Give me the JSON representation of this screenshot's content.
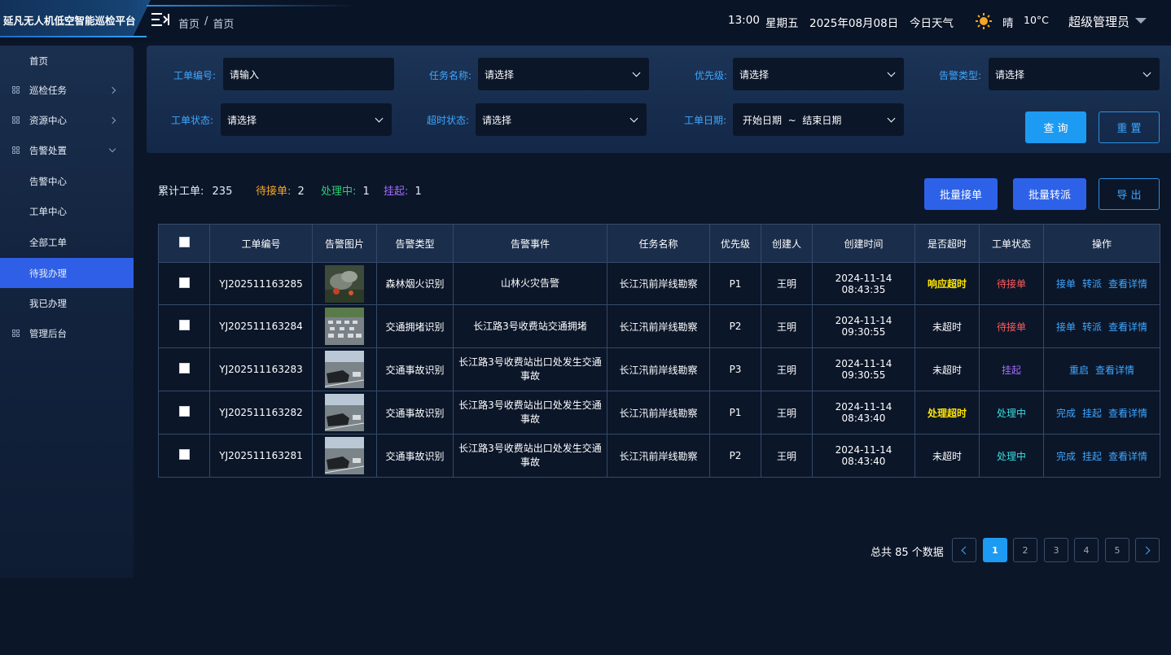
{
  "header": {
    "app_title": "延凡无人机低空智能巡检平台",
    "breadcrumb": [
      "首页",
      "/",
      "首页"
    ],
    "time": "13:00",
    "weekday": "星期五",
    "date": "2025年08月08日",
    "weather_label": "今日天气",
    "weather": "晴",
    "temperature": "10°C",
    "user": "超级管理员"
  },
  "sidebar": {
    "items": [
      {
        "label": "首页",
        "icon": "",
        "chevron": ""
      },
      {
        "label": "巡检任务",
        "icon": "grid-icon",
        "chevron": "right"
      },
      {
        "label": "资源中心",
        "icon": "grid-icon",
        "chevron": "right"
      },
      {
        "label": "告警处置",
        "icon": "grid-icon",
        "chevron": "down"
      },
      {
        "label": "告警中心",
        "icon": "",
        "chevron": ""
      },
      {
        "label": "工单中心",
        "icon": "",
        "chevron": ""
      },
      {
        "label": "全部工单",
        "icon": "",
        "chevron": ""
      },
      {
        "label": "待我办理",
        "icon": "",
        "chevron": "",
        "active": true
      },
      {
        "label": "我已办理",
        "icon": "",
        "chevron": ""
      },
      {
        "label": "管理后台",
        "icon": "grid-icon",
        "chevron": ""
      }
    ]
  },
  "filters": {
    "order_no": {
      "label": "工单编号:",
      "placeholder": "请输入"
    },
    "task_name": {
      "label": "任务名称:",
      "value": "请选择"
    },
    "priority": {
      "label": "优先级:",
      "value": "请选择"
    },
    "alarm_type": {
      "label": "告警类型:",
      "value": "请选择"
    },
    "order_status": {
      "label": "工单状态:",
      "value": "请选择"
    },
    "timeout_status": {
      "label": "超时状态:",
      "value": "请选择"
    },
    "order_date": {
      "label": "工单日期:",
      "value": "开始日期  ~  结束日期"
    },
    "query_label": "查 询",
    "reset_label": "重 置"
  },
  "summary": {
    "total_label": "累计工单:",
    "total": "235",
    "pending_label": "待接单:",
    "pending": "2",
    "processing_label": "处理中:",
    "processing": "1",
    "suspended_label": "挂起:",
    "suspended": "1"
  },
  "actions": {
    "batch_accept": "批量接单",
    "batch_transfer": "批量转派",
    "export": "导 出"
  },
  "table": {
    "columns": [
      "工单编号",
      "告警图片",
      "告警类型",
      "告警事件",
      "任务名称",
      "优先级",
      "创建人",
      "创建时间",
      "是否超时",
      "工单状态",
      "操作"
    ],
    "rows": [
      {
        "id": "YJ202511163285",
        "image": "forest-fire-thumbnail",
        "type": "森林烟火识别",
        "event": "山林火灾告警",
        "task": "长江汛前岸线勘察",
        "priority": "P1",
        "creator": "王明",
        "created": "2024-11-14 08:43:35",
        "timeout": "响应超时",
        "timeout_color": "#ffe600",
        "status": "待接单",
        "status_color": "#ff5b5b",
        "ops": [
          "接单",
          "转派",
          "查看详情"
        ]
      },
      {
        "id": "YJ202511163284",
        "image": "traffic-jam-thumbnail",
        "type": "交通拥堵识别",
        "event": "长江路3号收费站交通拥堵",
        "task": "长江汛前岸线勘察",
        "priority": "P2",
        "creator": "王明",
        "created": "2024-11-14 09:30:55",
        "timeout": "未超时",
        "timeout_color": "#ffffff",
        "status": "待接单",
        "status_color": "#ff5b5b",
        "ops": [
          "接单",
          "转派",
          "查看详情"
        ]
      },
      {
        "id": "YJ202511163283",
        "image": "traffic-accident-thumbnail",
        "type": "交通事故识别",
        "event": "长江路3号收费站出口处发生交通事故",
        "task": "长江汛前岸线勘察",
        "priority": "P3",
        "creator": "王明",
        "created": "2024-11-14 09:30:55",
        "timeout": "未超时",
        "timeout_color": "#ffffff",
        "status": "挂起",
        "status_color": "#a46bff",
        "ops": [
          "重启",
          "查看详情"
        ]
      },
      {
        "id": "YJ202511163282",
        "image": "traffic-accident-thumbnail",
        "type": "交通事故识别",
        "event": "长江路3号收费站出口处发生交通事故",
        "task": "长江汛前岸线勘察",
        "priority": "P1",
        "creator": "王明",
        "created": "2024-11-14 08:43:40",
        "timeout": "处理超时",
        "timeout_color": "#ffe600",
        "status": "处理中",
        "status_color": "#37e0e0",
        "ops": [
          "完成",
          "挂起",
          "查看详情"
        ]
      },
      {
        "id": "YJ202511163281",
        "image": "traffic-accident-thumbnail",
        "type": "交通事故识别",
        "event": "长江路3号收费站出口处发生交通事故",
        "task": "长江汛前岸线勘察",
        "priority": "P2",
        "creator": "王明",
        "created": "2024-11-14 08:43:40",
        "timeout": "未超时",
        "timeout_color": "#ffffff",
        "status": "处理中",
        "status_color": "#37e0e0",
        "ops": [
          "完成",
          "挂起",
          "查看详情"
        ]
      }
    ]
  },
  "pagination": {
    "total_text": "总共 85 个数据",
    "pages": [
      "1",
      "2",
      "3",
      "4",
      "5"
    ],
    "current": "1"
  },
  "colors": {
    "accent": "#1d9bf3",
    "label_blue": "#3fa7ff",
    "pending": "#f5a623",
    "processing": "#2ecc71",
    "suspended": "#a46bff",
    "active_menu": "#2f5fe6"
  }
}
